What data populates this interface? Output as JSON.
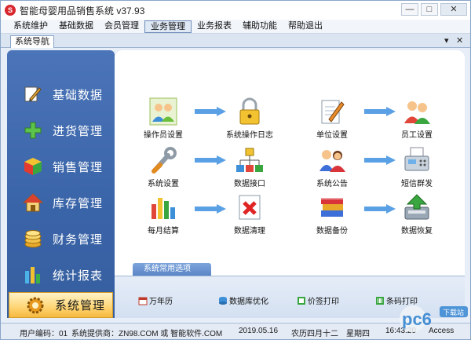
{
  "window": {
    "title": "智能母婴用品销售系统 v37.93",
    "app_icon_text": "S"
  },
  "titlebar_buttons": {
    "minimize": "—",
    "maximize": "□",
    "close": "✕"
  },
  "menu": {
    "items": [
      {
        "label": "系统维护"
      },
      {
        "label": "基础数据"
      },
      {
        "label": "会员管理"
      },
      {
        "label": "业务管理",
        "active": true
      },
      {
        "label": "业务报表"
      },
      {
        "label": "辅助功能"
      },
      {
        "label": "帮助退出"
      }
    ]
  },
  "nav": {
    "tab_label": "系统导航",
    "dropdown_glyph": "▾",
    "close_glyph": "✕"
  },
  "sidebar": {
    "items": [
      {
        "label": "基础数据",
        "icon": "pencil-icon"
      },
      {
        "label": "进货管理",
        "icon": "plus-icon"
      },
      {
        "label": "销售管理",
        "icon": "cube-icon"
      },
      {
        "label": "库存管理",
        "icon": "house-icon"
      },
      {
        "label": "财务管理",
        "icon": "coins-icon"
      },
      {
        "label": "统计报表",
        "icon": "bar-chart-icon"
      },
      {
        "label": "系统管理",
        "icon": "gear-icon",
        "active": true
      }
    ]
  },
  "functions": [
    {
      "label": "操作员设置",
      "icon": "users-icon"
    },
    {
      "label": "系统操作日志",
      "icon": "lock-icon"
    },
    {
      "label": "单位设置",
      "icon": "document-pen-icon"
    },
    {
      "label": "员工设置",
      "icon": "staff-icon"
    },
    {
      "label": "系统设置",
      "icon": "wrench-icon"
    },
    {
      "label": "数据接口",
      "icon": "network-icon"
    },
    {
      "label": "系统公告",
      "icon": "announcement-icon"
    },
    {
      "label": "短信群发",
      "icon": "fax-icon"
    },
    {
      "label": "每月结算",
      "icon": "bar-chart-icon"
    },
    {
      "label": "数据清理",
      "icon": "delete-doc-icon"
    },
    {
      "label": "数据备份",
      "icon": "books-icon"
    },
    {
      "label": "数据恢复",
      "icon": "restore-icon"
    }
  ],
  "common": {
    "header": "系统常用选项",
    "items": [
      {
        "label": "万年历",
        "icon": "calendar-icon"
      },
      {
        "label": "数据库优化",
        "icon": "database-icon"
      },
      {
        "label": "价签打印",
        "icon": "price-tag-icon"
      },
      {
        "label": "条码打印",
        "icon": "barcode-icon"
      }
    ]
  },
  "status": {
    "user_code": "用户编码：01",
    "provider": "系统提供商：ZN98.COM 或 智能软件.COM",
    "date": "2019.05.16",
    "lunar": "农历四月十二",
    "weekday": "星期四",
    "time": "16:43:20",
    "access": "Access"
  },
  "watermark": {
    "brand": "pc6",
    "sub": "下载站"
  },
  "colors": {
    "sidebar": "#3f69ad",
    "active_item": "#f8c85a",
    "arrow": "#3d8fe0"
  }
}
